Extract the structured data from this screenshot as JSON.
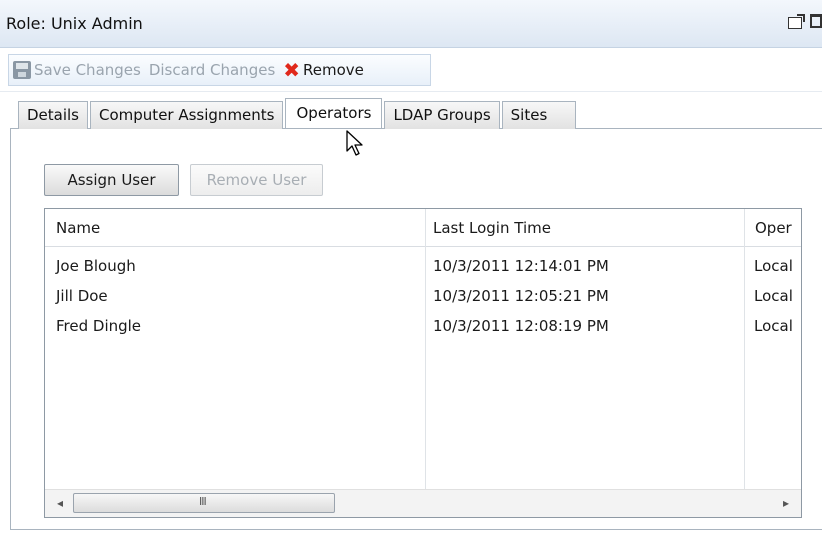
{
  "window": {
    "title": "Role: Unix Admin",
    "icons": [
      "popout-icon",
      "maximize-icon"
    ]
  },
  "toolbar": {
    "save_label": "Save Changes",
    "discard_label": "Discard Changes",
    "remove_label": "Remove"
  },
  "tabs": [
    {
      "label": "Details"
    },
    {
      "label": "Computer Assignments"
    },
    {
      "label": "Operators"
    },
    {
      "label": "LDAP Groups"
    },
    {
      "label": "Sites"
    }
  ],
  "active_tab": "Operators",
  "actions": {
    "assign_label": "Assign User",
    "remove_label": "Remove User"
  },
  "grid": {
    "columns": [
      "Name",
      "Last Login Time",
      "Oper"
    ],
    "rows": [
      {
        "name": "Joe Blough",
        "last_login": "10/3/2011 12:14:01 PM",
        "oper": "Local"
      },
      {
        "name": "Jill Doe",
        "last_login": "10/3/2011 12:05:21 PM",
        "oper": "Local"
      },
      {
        "name": "Fred Dingle",
        "last_login": "10/3/2011 12:08:19 PM",
        "oper": "Local"
      }
    ],
    "scroll_left": "◂",
    "scroll_right": "▸",
    "scroll_grip": "III"
  }
}
